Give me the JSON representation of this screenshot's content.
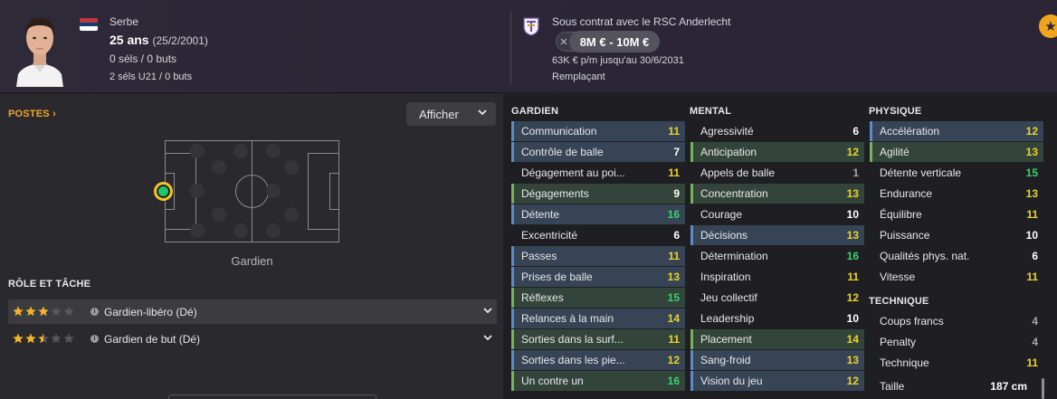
{
  "header": {
    "nationality": "Serbe",
    "age": "25 ans",
    "dob": "(25/2/2001)",
    "caps": "0 séls / 0 buts",
    "u21_caps": "2 séls U21 / 0 buts",
    "contract": "Sous contrat avec le RSC Anderlecht",
    "value_x": "✕",
    "value": "8M € - 10M €",
    "wage": "63K € p/m jusqu'au 30/6/2031",
    "squad_status": "Remplaçant",
    "flag_colors": [
      "#c6363c",
      "#0c4076",
      "#ffffff"
    ],
    "favourite_icon": "star-icon"
  },
  "positions": {
    "title": "POSTES",
    "title_arrow": "›",
    "display_button": "Afficher",
    "pitch_label": "Gardien",
    "role_title": "RÔLE ET TÂCHE",
    "roles": [
      {
        "name": "Gardien-libéro (Dé)",
        "stars": 3.0
      },
      {
        "name": "Gardien de but (Dé)",
        "stars": 2.5
      }
    ]
  },
  "attributes": {
    "goalkeeper": {
      "title": "GARDIEN",
      "items": [
        {
          "label": "Communication",
          "value": "11",
          "hl": "blue"
        },
        {
          "label": "Contrôle de balle",
          "value": "7",
          "hl": "blue"
        },
        {
          "label": "Dégagement au poi...",
          "value": "11",
          "hl": ""
        },
        {
          "label": "Dégagements",
          "value": "9",
          "hl": "green"
        },
        {
          "label": "Détente",
          "value": "16",
          "hl": "blue"
        },
        {
          "label": "Excentricité",
          "value": "6",
          "hl": ""
        },
        {
          "label": "Passes",
          "value": "11",
          "hl": "blue"
        },
        {
          "label": "Prises de balle",
          "value": "13",
          "hl": "blue"
        },
        {
          "label": "Réflexes",
          "value": "15",
          "hl": "green"
        },
        {
          "label": "Relances à la main",
          "value": "14",
          "hl": "blue"
        },
        {
          "label": "Sorties dans la surf...",
          "value": "11",
          "hl": "green"
        },
        {
          "label": "Sorties dans les pie...",
          "value": "12",
          "hl": "blue"
        },
        {
          "label": "Un contre un",
          "value": "16",
          "hl": "green"
        }
      ]
    },
    "mental": {
      "title": "MENTAL",
      "items": [
        {
          "label": "Agressivité",
          "value": "6",
          "hl": ""
        },
        {
          "label": "Anticipation",
          "value": "12",
          "hl": "green"
        },
        {
          "label": "Appels de balle",
          "value": "1",
          "hl": ""
        },
        {
          "label": "Concentration",
          "value": "13",
          "hl": "green"
        },
        {
          "label": "Courage",
          "value": "10",
          "hl": ""
        },
        {
          "label": "Décisions",
          "value": "13",
          "hl": "blue"
        },
        {
          "label": "Détermination",
          "value": "16",
          "hl": ""
        },
        {
          "label": "Inspiration",
          "value": "11",
          "hl": ""
        },
        {
          "label": "Jeu collectif",
          "value": "12",
          "hl": ""
        },
        {
          "label": "Leadership",
          "value": "10",
          "hl": ""
        },
        {
          "label": "Placement",
          "value": "14",
          "hl": "green"
        },
        {
          "label": "Sang-froid",
          "value": "13",
          "hl": "blue"
        },
        {
          "label": "Vision du jeu",
          "value": "12",
          "hl": "blue"
        }
      ]
    },
    "physical": {
      "title": "PHYSIQUE",
      "items": [
        {
          "label": "Accélération",
          "value": "12",
          "hl": "blue"
        },
        {
          "label": "Agilité",
          "value": "13",
          "hl": "green"
        },
        {
          "label": "Détente verticale",
          "value": "15",
          "hl": ""
        },
        {
          "label": "Endurance",
          "value": "13",
          "hl": ""
        },
        {
          "label": "Équilibre",
          "value": "11",
          "hl": ""
        },
        {
          "label": "Puissance",
          "value": "10",
          "hl": ""
        },
        {
          "label": "Qualités phys. nat.",
          "value": "6",
          "hl": ""
        },
        {
          "label": "Vitesse",
          "value": "11",
          "hl": ""
        }
      ]
    },
    "technical": {
      "title": "TECHNIQUE",
      "items": [
        {
          "label": "Coups francs",
          "value": "4",
          "hl": ""
        },
        {
          "label": "Penalty",
          "value": "4",
          "hl": ""
        },
        {
          "label": "Technique",
          "value": "11",
          "hl": ""
        }
      ]
    },
    "height": {
      "label": "Taille",
      "value": "187 cm"
    }
  }
}
